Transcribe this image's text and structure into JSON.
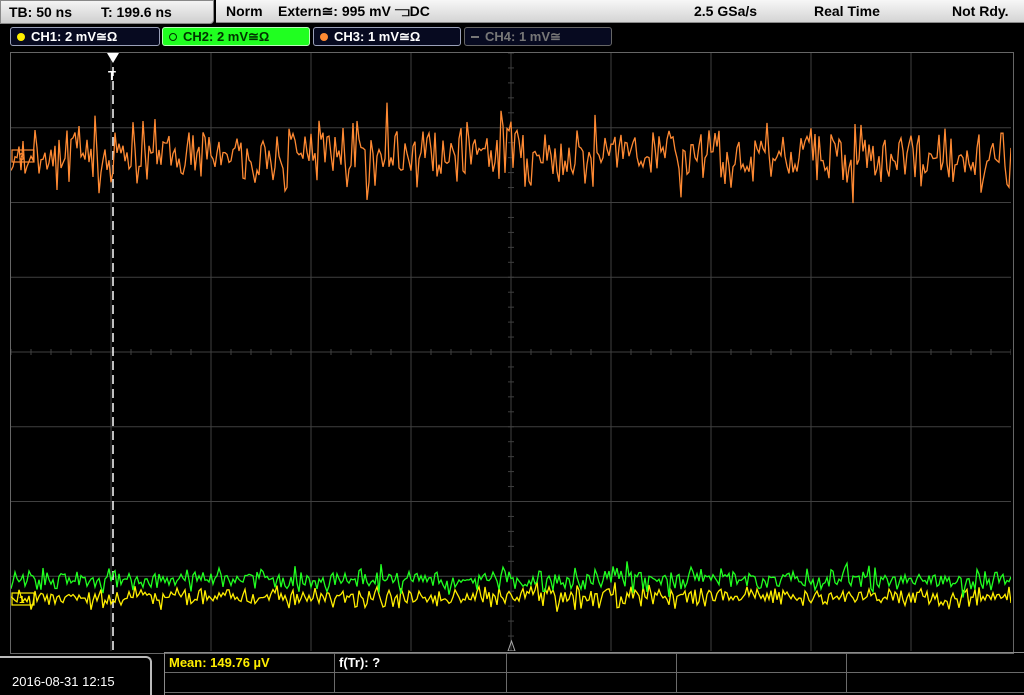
{
  "header": {
    "timebase": "TB: 50 ns",
    "trigger_time": "T: 199.6 ns",
    "trigger_mode": "Norm",
    "trigger_source": "Extern≅: 995 mV ⫎DC",
    "sample_rate": "2.5 GSa/s",
    "acq_mode": "Real Time",
    "status": "Not Rdy."
  },
  "channels": [
    {
      "label": "CH1: 2 mV≅Ω",
      "color": "#ffee00",
      "state": "on"
    },
    {
      "label": "CH2: 2 mV≅Ω",
      "color": "#20ff20",
      "state": "selected"
    },
    {
      "label": "CH3: 1 mV≅Ω",
      "color": "#ff8a33",
      "state": "on"
    },
    {
      "label": "CH4: 1 mV≅",
      "color": "#777777",
      "state": "off"
    }
  ],
  "screen": {
    "trigger_marker": "T",
    "ch3_marker": "3",
    "ch1_marker": "1"
  },
  "footer": {
    "datetime": "2016-08-31 12:15",
    "measurements": [
      {
        "text": "Mean: 149.76 µV",
        "color": "#ffee00"
      },
      {
        "text": "f(Tr): ?",
        "color": "#ffffff"
      }
    ]
  },
  "colors": {
    "ch1": "#ffee00",
    "ch2": "#20ff20",
    "ch3": "#ff8a33",
    "grid": "#404040"
  }
}
